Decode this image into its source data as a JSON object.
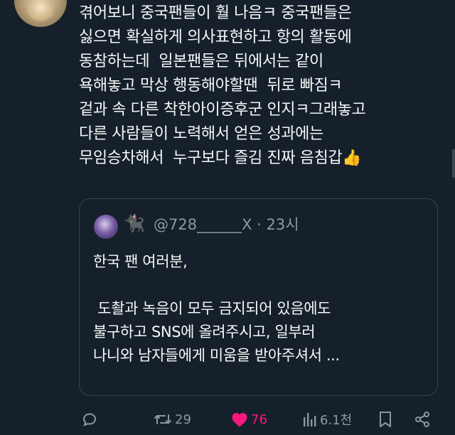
{
  "tweet": {
    "lines": [
      "겪어보니 중국팬들이 훨 나음ㅋ 중국팬들은",
      "싫으면 확실하게 의사표현하고 항의 활동에",
      "동참하는데  일본팬들은 뒤에서는 같이",
      "욕해놓고 막상 행동해야할땐  뒤로 빠짐ㅋ",
      "겉과 속 다른 착한아이증후군 인지ㅋ그래놓고",
      "다른 사람들이 노력해서 얻은 성과에는",
      "무임승차해서  누구보다 즐김 진짜 음침갑"
    ],
    "emoji": "👍"
  },
  "quote": {
    "name_emoji": "🐈‍⬛",
    "handle": "@728______X · 23시",
    "lines": [
      "한국 팬 여러분,",
      "",
      " 도촬과 녹음이 모두 금지되어 있음에도",
      "불구하고 SNS에 올려주시고, 일부러",
      "나니와 남자들에게 미움을 받아주셔서 ..."
    ]
  },
  "actions": {
    "retweets": "29",
    "likes": "76",
    "views": "6.1천"
  },
  "colors": {
    "background": "#15202b",
    "text": "#f7f9f9",
    "muted": "#8b98a5",
    "like": "#f91880"
  }
}
